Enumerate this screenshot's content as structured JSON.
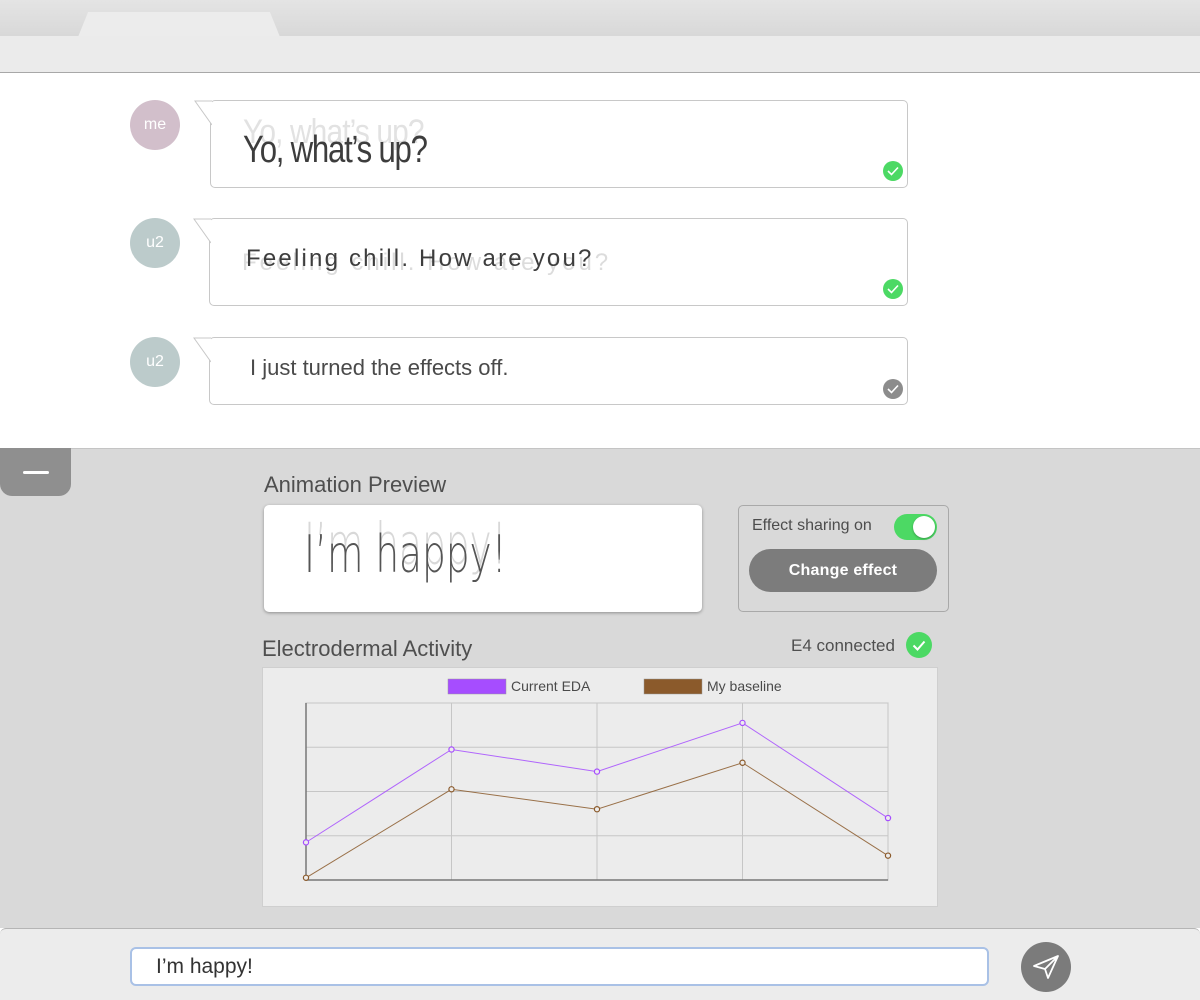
{
  "colors": {
    "accent_green": "#4cd964",
    "read_gray": "#8c8c8c",
    "avatar_me": "#d2bfcb",
    "avatar_u2": "#bccbcb",
    "eda_current": "#a64dff",
    "eda_baseline": "#8b5a2b"
  },
  "messages": [
    {
      "sender": "me",
      "text": "Yo, what’s up?",
      "status_icon": "check-green-icon"
    },
    {
      "sender": "u2",
      "text": "Feeling chill. How are you?",
      "status_icon": "check-green-icon"
    },
    {
      "sender": "u2",
      "text": "I just turned the effects off.",
      "status_icon": "check-gray-icon"
    }
  ],
  "panel": {
    "collapse_icon": "minus-icon",
    "animation_preview_title": "Animation Preview",
    "preview_text": "I’m happy!",
    "effect_sharing_label": "Effect sharing on",
    "effect_sharing_enabled": true,
    "change_effect_label": "Change effect",
    "eda_title": "Electrodermal Activity",
    "e4_status": "E4 connected",
    "e4_status_icon": "check-green-icon"
  },
  "chart_data": {
    "type": "line",
    "title": "",
    "xlabel": "",
    "ylabel": "",
    "legend_position": "top",
    "grid": true,
    "x": [
      0,
      1,
      2,
      3,
      4
    ],
    "ylim": [
      0,
      4
    ],
    "series": [
      {
        "name": "Current EDA",
        "color": "#a64dff",
        "values": [
          0.85,
          2.95,
          2.45,
          3.55,
          1.4
        ]
      },
      {
        "name": "My baseline",
        "color": "#8b5a2b",
        "values": [
          0.05,
          2.05,
          1.6,
          2.65,
          0.55
        ]
      }
    ]
  },
  "composer": {
    "input_value": "I’m happy!",
    "send_icon": "paper-plane-icon"
  }
}
